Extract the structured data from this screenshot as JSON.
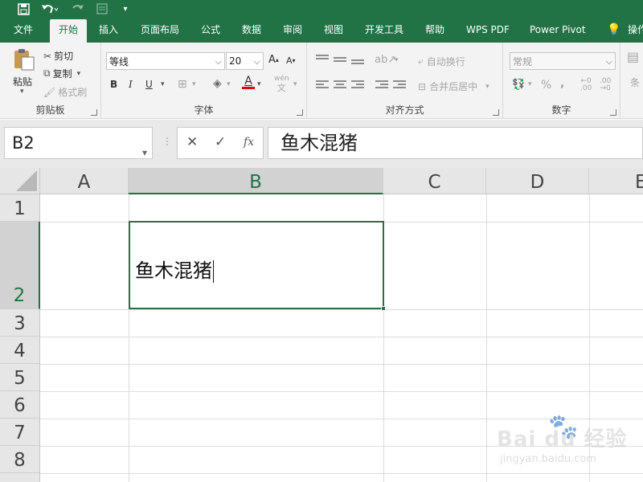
{
  "qat": {
    "save_icon": "save-icon",
    "undo_icon": "undo-icon",
    "redo_icon": "redo-icon",
    "customize_icon": "chevron-down-icon"
  },
  "tabs": [
    {
      "label": "文件"
    },
    {
      "label": "开始",
      "active": true
    },
    {
      "label": "插入"
    },
    {
      "label": "页面布局"
    },
    {
      "label": "公式"
    },
    {
      "label": "数据"
    },
    {
      "label": "审阅"
    },
    {
      "label": "视图"
    },
    {
      "label": "开发工具"
    },
    {
      "label": "帮助"
    },
    {
      "label": "WPS PDF"
    },
    {
      "label": "Power Pivot"
    },
    {
      "label": "操作"
    }
  ],
  "ribbon": {
    "clipboard": {
      "label": "剪贴板",
      "paste": "粘贴",
      "cut": "剪切",
      "copy": "复制",
      "format_painter": "格式刷"
    },
    "font": {
      "label": "字体",
      "font_name": "等线",
      "font_size": "20",
      "bold": "B",
      "italic": "I",
      "underline": "U",
      "font_color_letter": "A",
      "font_color": "#e00000",
      "phonetic": "wén"
    },
    "alignment": {
      "label": "对齐方式",
      "wrap_text": "自动换行",
      "merge_center": "合并后居中"
    },
    "number": {
      "label": "数字",
      "format": "常规",
      "percent": "%",
      "comma": ","
    },
    "styles": {
      "partial_label": "条"
    }
  },
  "formula_bar": {
    "name_box": "B2",
    "cancel": "✕",
    "enter": "✓",
    "fx": "fx",
    "value": "鱼木混猪"
  },
  "grid": {
    "columns": [
      "A",
      "B",
      "C",
      "D",
      "E"
    ],
    "selected_column": "B",
    "rows": [
      "1",
      "2",
      "3",
      "4",
      "5",
      "6",
      "7",
      "8"
    ],
    "selected_row": "2",
    "active_cell_value": "鱼木混猪"
  },
  "watermark": {
    "main": "Bai du 经验",
    "sub": "jingyan.baidu.com"
  },
  "colors": {
    "brand": "#217346",
    "ribbon_bg": "#f3f3f3"
  }
}
